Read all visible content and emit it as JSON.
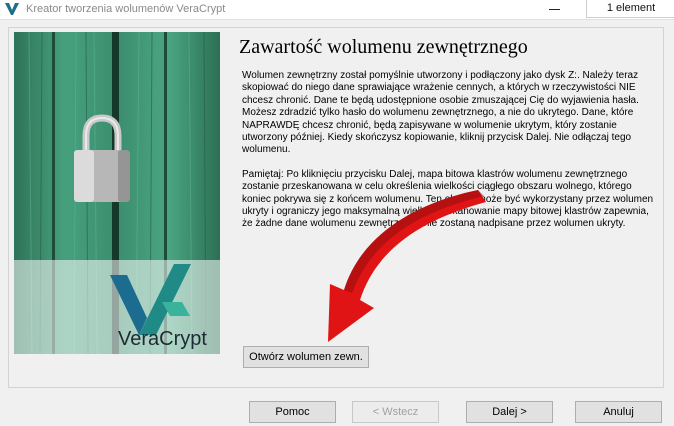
{
  "window": {
    "title": "Kreator tworzenia wolumenów VeraCrypt",
    "tooltip": "1 element"
  },
  "side_image": {
    "brand": "VeraCrypt",
    "brand_part1": "Vera",
    "brand_part2": "Crypt"
  },
  "content": {
    "heading": "Zawartość wolumenu zewnętrznego",
    "paragraph1": "Wolumen zewnętrzny został pomyślnie utworzony i podłączony jako dysk Z:. Należy teraz skopiować do niego dane sprawiające wrażenie cennych, a których w rzeczywistości NIE chcesz chronić. Dane te będą udostępnione osobie zmuszającej Cię do wyjawienia hasła. Możesz zdradzić tylko hasło do wolumenu zewnętrznego, a nie do ukrytego. Dane, które NAPRAWDĘ chcesz chronić, będą zapisywane w wolumenie ukrytym, który zostanie utworzony później. Kiedy skończysz kopiowanie, kliknij przycisk Dalej. Nie odłączaj tego wolumenu.",
    "paragraph2": "Pamiętaj: Po kliknięciu przycisku Dalej, mapa bitowa klastrów wolumenu zewnętrznego zostanie przeskanowana w celu określenia wielkości ciągłego obszaru wolnego, którego koniec pokrywa się z końcem wolumenu. Ten obszar może być wykorzystany przez wolumen ukryty i ograniczy jego maksymalną wielkość. Skanowanie mapy bitowej klastrów zapewnia, że żadne dane wolumenu zewnętrznego nie zostaną nadpisane przez wolumen ukryty.",
    "open_button": "Otwórz wolumen zewn."
  },
  "buttons": {
    "help": "Pomoc",
    "back": "< Wstecz",
    "next": "Dalej >",
    "cancel": "Anuluj"
  },
  "colors": {
    "wood": "#3b8a6d",
    "arrow": "#e01414",
    "logo_teal": "#1f8a86"
  }
}
